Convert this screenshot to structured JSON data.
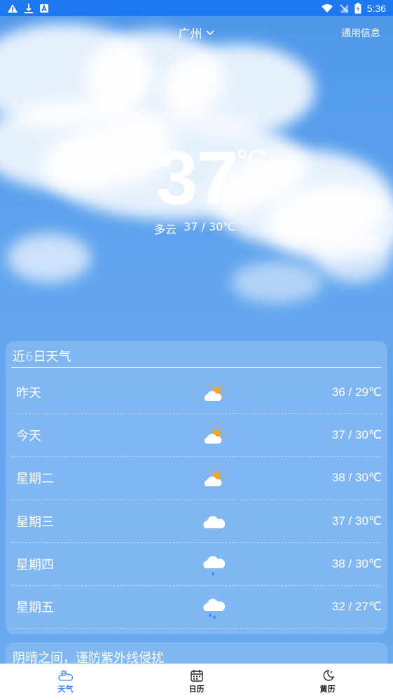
{
  "status_bar": {
    "time": "5:36",
    "left_icons": [
      "warning-icon",
      "download-icon",
      "app-a-icon"
    ],
    "right_icons": [
      "wifi-icon",
      "no-signal-icon",
      "battery-icon"
    ]
  },
  "header": {
    "city": "广州",
    "general_info": "通用信息"
  },
  "current": {
    "temperature": "37",
    "unit": "°C",
    "condition": "多云",
    "range": "37 / 30℃"
  },
  "forecast": {
    "title_prefix": "近",
    "title_count": "6",
    "title_suffix": "日天气",
    "days": [
      {
        "day": "昨天",
        "icon": "partly-cloudy-icon",
        "range": "36 / 29℃"
      },
      {
        "day": "今天",
        "icon": "partly-cloudy-icon",
        "range": "37 / 30℃"
      },
      {
        "day": "星期二",
        "icon": "partly-cloudy-icon",
        "range": "38 / 30℃"
      },
      {
        "day": "星期三",
        "icon": "cloud-icon",
        "range": "37 / 30℃"
      },
      {
        "day": "星期四",
        "icon": "light-rain-icon",
        "range": "38 / 30℃"
      },
      {
        "day": "星期五",
        "icon": "rain-icon",
        "range": "32 / 27℃"
      }
    ]
  },
  "tip": {
    "text": "阴晴之间，谨防紫外线侵扰"
  },
  "nav": [
    {
      "label": "天气",
      "icon": "weather-icon",
      "active": true
    },
    {
      "label": "日历",
      "icon": "calendar-icon",
      "active": false
    },
    {
      "label": "黄历",
      "icon": "moon-icon",
      "active": false
    }
  ],
  "colors": {
    "status_bar": "#1e78f0",
    "accent": "#3d86e6",
    "sun": "#f5a623"
  }
}
